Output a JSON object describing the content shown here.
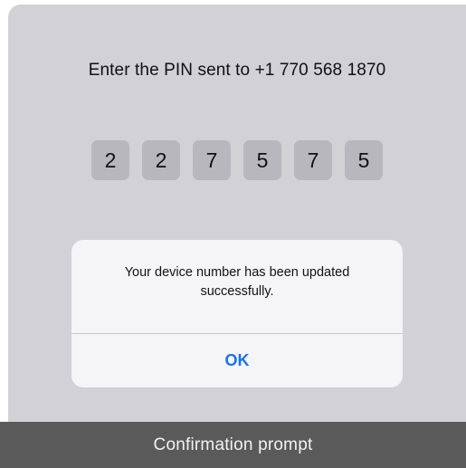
{
  "screen": {
    "pin_prompt": "Enter the PIN sent to +1 770 568 1870",
    "pin_digits": [
      "2",
      "2",
      "7",
      "5",
      "7",
      "5"
    ]
  },
  "alert": {
    "message": "Your device number has been updated successfully.",
    "ok_label": "OK"
  },
  "caption": {
    "text": "Confirmation prompt"
  },
  "colors": {
    "background": "#d1d1d6",
    "pin_box": "#b7b7bd",
    "alert_background": "#f5f5f7",
    "ok_button": "#1a73e8",
    "caption_bar": "#5a5a5a"
  }
}
